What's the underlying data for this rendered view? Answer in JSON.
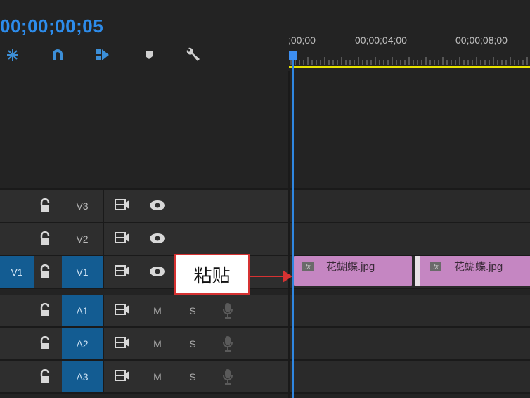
{
  "header": {
    "timecode": "00;00;00;05",
    "tools": [
      {
        "icon": "snap-icon"
      },
      {
        "icon": "linked-selection-icon"
      },
      {
        "icon": "add-marker-icon"
      },
      {
        "icon": "marker-icon"
      },
      {
        "icon": "wrench-icon"
      }
    ]
  },
  "ruler": {
    "labels": [
      ";00;00",
      "00;00;04;00",
      "00;00;08;00"
    ]
  },
  "tracks": [
    {
      "source": "",
      "lock": "lock-icon",
      "name": "V3",
      "type": "video"
    },
    {
      "source": "",
      "lock": "lock-icon",
      "name": "V2",
      "type": "video"
    },
    {
      "source": "V1",
      "lock": "lock-icon",
      "name": "V1",
      "type": "video"
    },
    {
      "source": "",
      "lock": "lock-icon",
      "name": "A1",
      "type": "audio",
      "mute": "M",
      "solo": "S"
    },
    {
      "source": "",
      "lock": "lock-icon",
      "name": "A2",
      "type": "audio",
      "mute": "M",
      "solo": "S"
    },
    {
      "source": "",
      "lock": "lock-icon",
      "name": "A3",
      "type": "audio",
      "mute": "M",
      "solo": "S"
    }
  ],
  "clips": [
    {
      "fx": "fx",
      "name": "花蝴蝶.jpg"
    },
    {
      "fx": "fx",
      "name": "花蝴蝶.jpg"
    }
  ],
  "callout": {
    "text": "粘贴"
  },
  "colors": {
    "background": "#232323",
    "timecode": "#2d8ceb",
    "playhead": "#2f86e0",
    "work_area": "#e8e400",
    "clip": "#c586c2",
    "track_target": "#135c92",
    "callout_border": "#d63232"
  }
}
